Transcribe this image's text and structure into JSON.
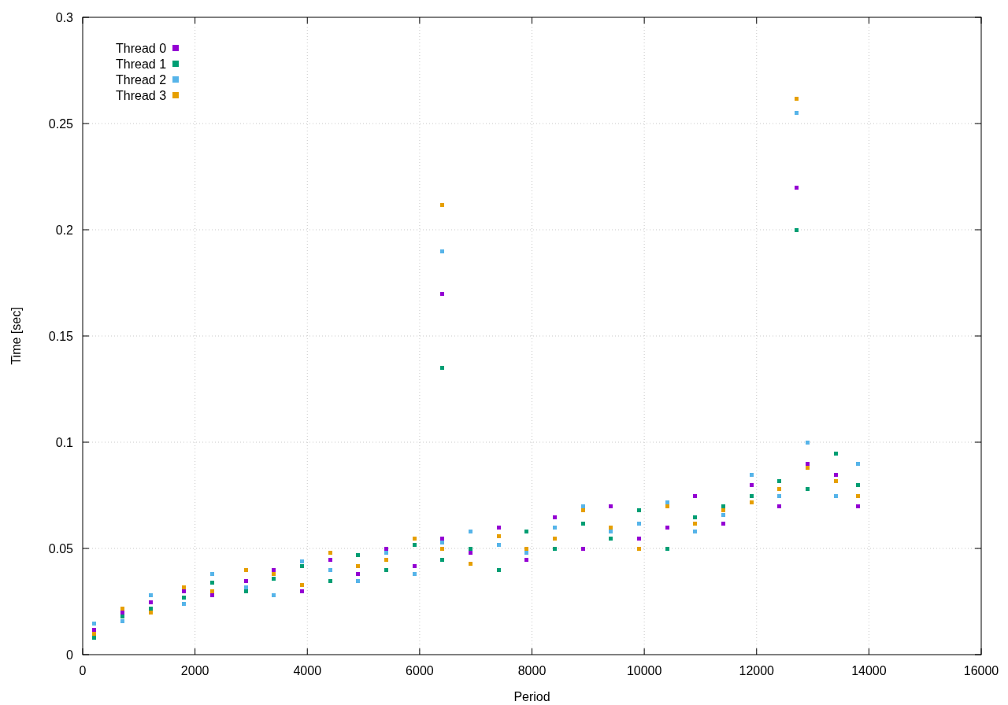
{
  "chart_data": {
    "type": "scatter",
    "grid": true,
    "legend": "top-left",
    "xlabel": "Period",
    "ylabel": "Time [sec]",
    "xlim": [
      0,
      16000
    ],
    "ylim": [
      0,
      0.3
    ],
    "xticks": [
      0,
      2000,
      4000,
      6000,
      8000,
      10000,
      12000,
      14000,
      16000
    ],
    "yticks": [
      {
        "value": 0,
        "label": "0"
      },
      {
        "value": 0.05,
        "label": "0.05"
      },
      {
        "value": 0.1,
        "label": "0.1"
      },
      {
        "value": 0.15,
        "label": "0.15"
      },
      {
        "value": 0.2,
        "label": "0.2"
      },
      {
        "value": 0.25,
        "label": "0.25"
      },
      {
        "value": 0.3,
        "label": "0.3"
      }
    ],
    "x": [
      200,
      700,
      1200,
      1800,
      2300,
      2900,
      3400,
      3900,
      4400,
      4900,
      5400,
      5900,
      6400,
      6900,
      7400,
      7900,
      8400,
      8900,
      9400,
      9900,
      10400,
      10900,
      11400,
      11900,
      12400,
      12900,
      13400,
      13800,
      6400,
      12700
    ],
    "series": [
      {
        "name": "Thread 0",
        "color": "#9400d3",
        "values": [
          0.012,
          0.02,
          0.025,
          0.03,
          0.028,
          0.035,
          0.04,
          0.03,
          0.045,
          0.038,
          0.05,
          0.042,
          0.055,
          0.048,
          0.06,
          0.045,
          0.065,
          0.05,
          0.07,
          0.055,
          0.06,
          0.075,
          0.062,
          0.08,
          0.07,
          0.09,
          0.085,
          0.07,
          0.17,
          0.22
        ]
      },
      {
        "name": "Thread 1",
        "color": "#009e73",
        "values": [
          0.008,
          0.018,
          0.022,
          0.027,
          0.034,
          0.03,
          0.036,
          0.042,
          0.035,
          0.047,
          0.04,
          0.052,
          0.045,
          0.05,
          0.04,
          0.058,
          0.05,
          0.062,
          0.055,
          0.068,
          0.05,
          0.065,
          0.07,
          0.075,
          0.082,
          0.078,
          0.095,
          0.08,
          0.135,
          0.2
        ]
      },
      {
        "name": "Thread 2",
        "color": "#56b4e9",
        "values": [
          0.015,
          0.016,
          0.028,
          0.024,
          0.038,
          0.032,
          0.028,
          0.044,
          0.04,
          0.035,
          0.048,
          0.038,
          0.053,
          0.058,
          0.052,
          0.048,
          0.06,
          0.07,
          0.058,
          0.062,
          0.072,
          0.058,
          0.066,
          0.085,
          0.075,
          0.1,
          0.075,
          0.09,
          0.19,
          0.255
        ]
      },
      {
        "name": "Thread 3",
        "color": "#e69f00",
        "values": [
          0.01,
          0.022,
          0.02,
          0.032,
          0.03,
          0.04,
          0.038,
          0.033,
          0.048,
          0.042,
          0.045,
          0.055,
          0.05,
          0.043,
          0.056,
          0.05,
          0.055,
          0.068,
          0.06,
          0.05,
          0.07,
          0.062,
          0.068,
          0.072,
          0.078,
          0.088,
          0.082,
          0.075,
          0.212,
          0.262
        ]
      }
    ]
  }
}
